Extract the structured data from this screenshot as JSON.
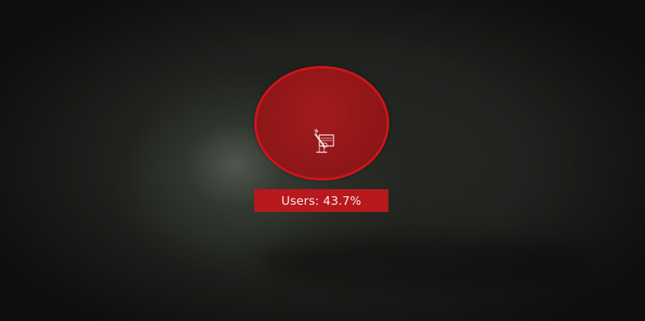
{
  "segment": {
    "label": "Users: 43.7%",
    "icon": "sparkler-desk-icon",
    "accent_color": "#d0151a",
    "fill_color": "#9c1618",
    "label_bg": "#b8191d"
  }
}
